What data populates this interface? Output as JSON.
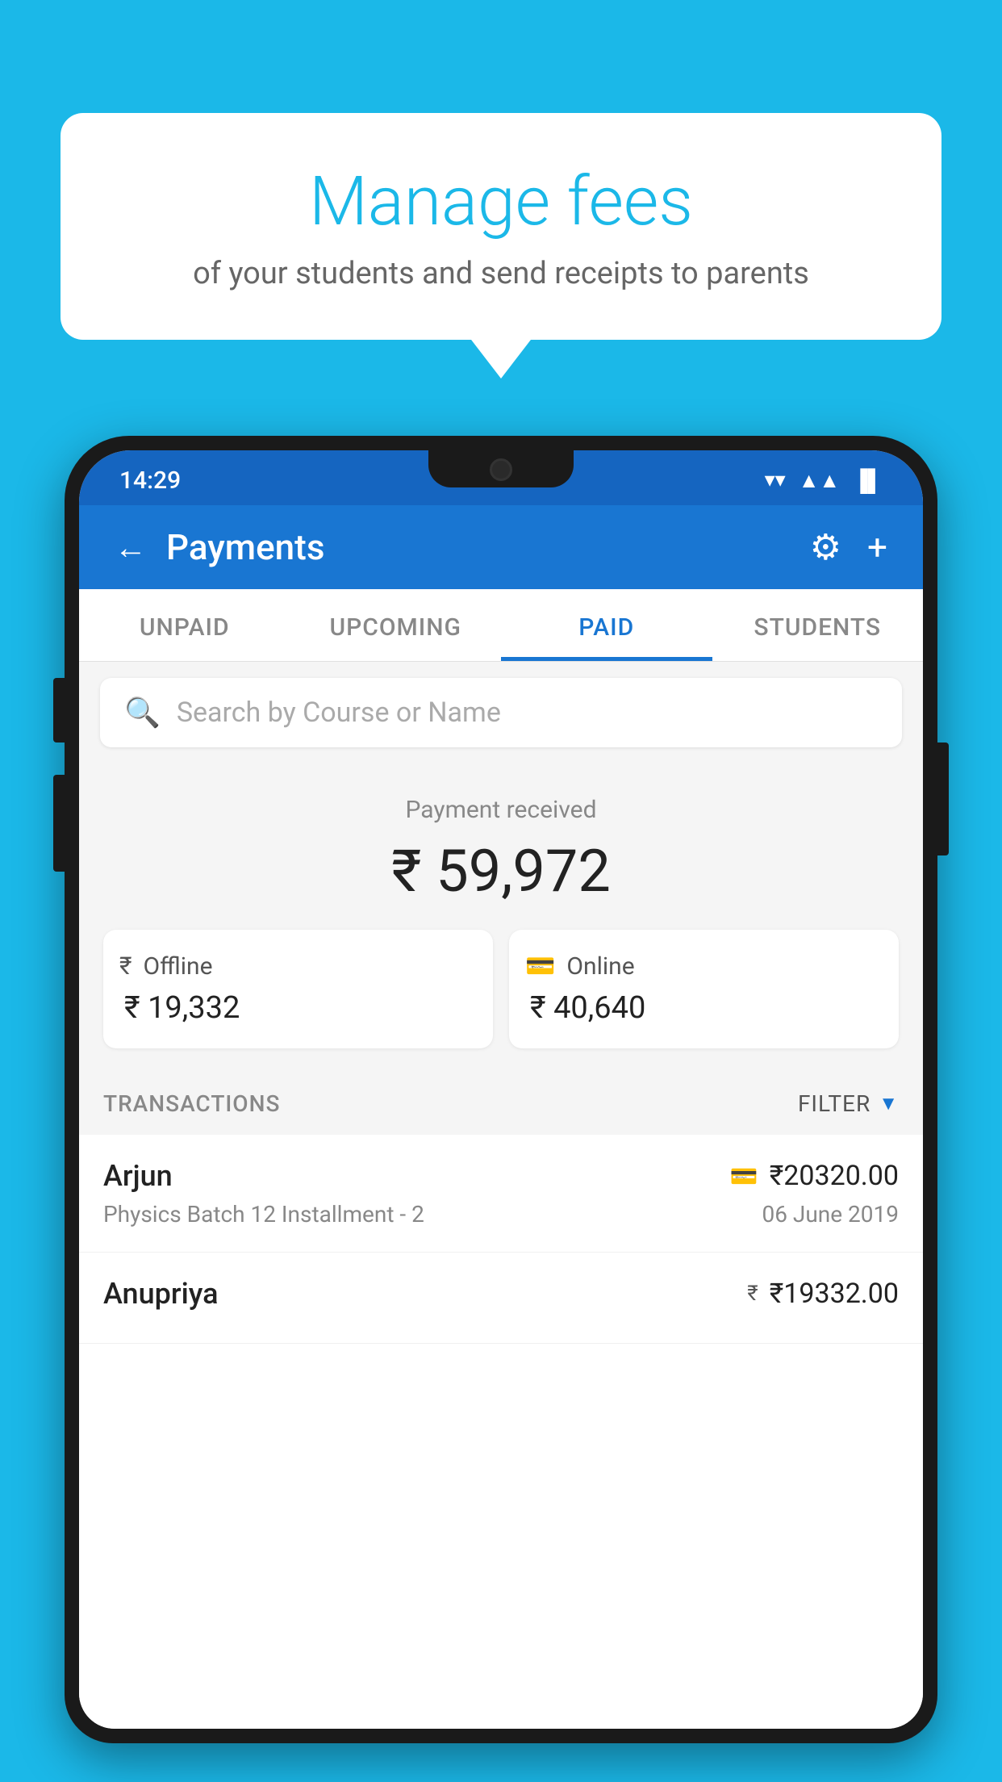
{
  "page": {
    "background_color": "#1BB8E8"
  },
  "speech_bubble": {
    "title": "Manage fees",
    "subtitle": "of your students and send receipts to parents"
  },
  "status_bar": {
    "time": "14:29",
    "wifi": "▲",
    "signal": "▲",
    "battery": "▐"
  },
  "app_bar": {
    "title": "Payments",
    "back_label": "←",
    "gear_label": "⚙",
    "plus_label": "+"
  },
  "tabs": [
    {
      "label": "UNPAID",
      "active": false
    },
    {
      "label": "UPCOMING",
      "active": false
    },
    {
      "label": "PAID",
      "active": true
    },
    {
      "label": "STUDENTS",
      "active": false
    }
  ],
  "search": {
    "placeholder": "Search by Course or Name"
  },
  "payment_summary": {
    "label": "Payment received",
    "amount": "₹ 59,972",
    "offline": {
      "label": "Offline",
      "amount": "₹ 19,332"
    },
    "online": {
      "label": "Online",
      "amount": "₹ 40,640"
    }
  },
  "transactions_section": {
    "label": "TRANSACTIONS",
    "filter_label": "FILTER"
  },
  "transactions": [
    {
      "name": "Arjun",
      "description": "Physics Batch 12 Installment - 2",
      "amount": "₹20320.00",
      "date": "06 June 2019",
      "payment_type": "card"
    },
    {
      "name": "Anupriya",
      "description": "",
      "amount": "₹19332.00",
      "date": "",
      "payment_type": "cash"
    }
  ]
}
